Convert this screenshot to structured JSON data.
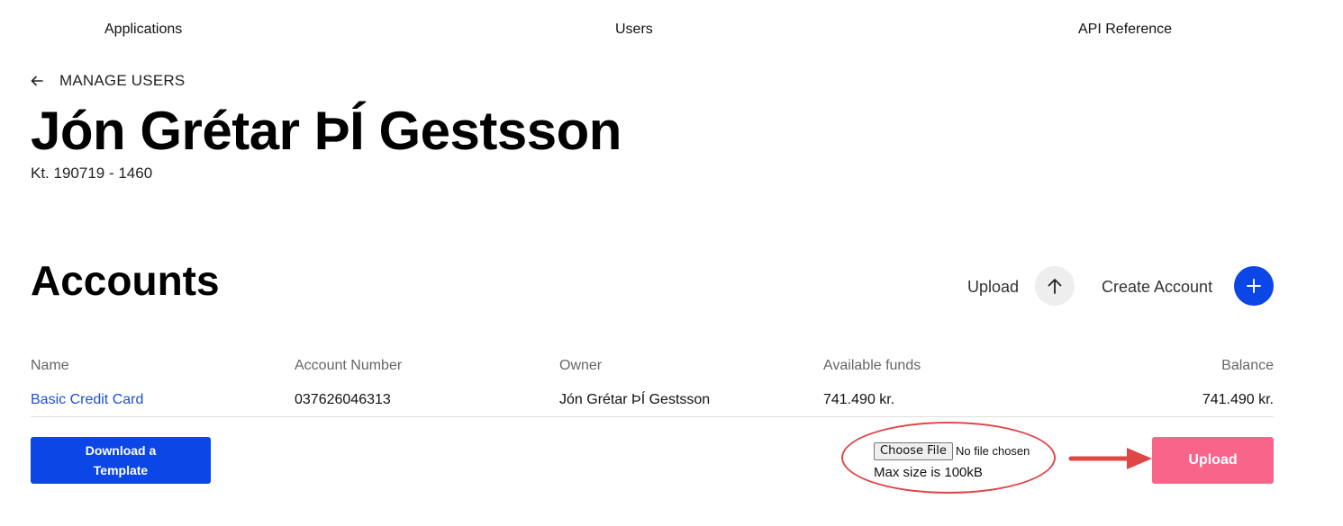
{
  "nav": {
    "applications": "Applications",
    "users": "Users",
    "api_reference": "API Reference"
  },
  "header": {
    "back_label": "MANAGE USERS",
    "user_name": "Jón Grétar ÞÍ Gestsson",
    "kennitala": "Kt. 190719 - 1460"
  },
  "accounts": {
    "title": "Accounts",
    "upload_label": "Upload",
    "create_label": "Create Account",
    "columns": {
      "name": "Name",
      "account_number": "Account Number",
      "owner": "Owner",
      "available_funds": "Available funds",
      "balance": "Balance"
    },
    "rows": [
      {
        "name": "Basic Credit Card",
        "account_number": "037626046313",
        "owner": "Jón Grétar ÞÍ Gestsson",
        "available_funds": "741.490 kr.",
        "balance": "741.490 kr."
      }
    ]
  },
  "footer": {
    "download_template": "Download a Template",
    "choose_file": "Choose File",
    "no_file": "No file chosen",
    "max_size": "Max size is 100kB",
    "upload_button": "Upload"
  },
  "colors": {
    "primary_blue": "#0b46e6",
    "upload_pink": "#f9648a",
    "link_blue": "#1a4fd6",
    "annotation_red": "#e04646"
  },
  "icons": {
    "back": "arrow-left-icon",
    "upload": "arrow-up-icon",
    "create": "plus-icon"
  }
}
